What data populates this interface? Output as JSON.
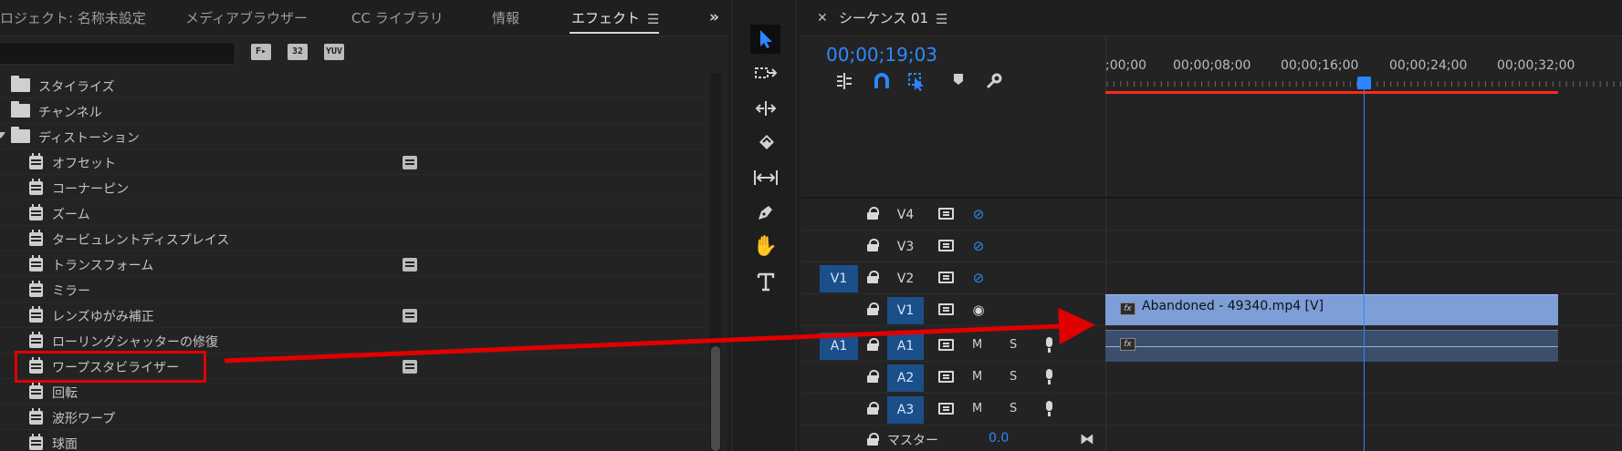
{
  "effects_panel": {
    "tabs": [
      "ロジェクト: 名称未設定",
      "メディアブラウザー",
      "CC ライブラリ",
      "情報",
      "エフェクト"
    ],
    "active_tab": "エフェクト",
    "search": {
      "value": "",
      "placeholder": ""
    },
    "filters": [
      "32",
      "YUV"
    ],
    "items": [
      {
        "label": "スタイライズ",
        "type": "folder"
      },
      {
        "label": "チャンネル",
        "type": "folder"
      },
      {
        "label": "ディストーション",
        "type": "folder",
        "expanded": true
      },
      {
        "label": "オフセット",
        "type": "effect",
        "accelerated": true
      },
      {
        "label": "コーナーピン",
        "type": "effect"
      },
      {
        "label": "ズーム",
        "type": "effect"
      },
      {
        "label": "タービュレントディスプレイス",
        "type": "effect"
      },
      {
        "label": "トランスフォーム",
        "type": "effect",
        "accelerated": true
      },
      {
        "label": "ミラー",
        "type": "effect"
      },
      {
        "label": "レンズゆがみ補正",
        "type": "effect",
        "accelerated": true
      },
      {
        "label": "ローリングシャッターの修復",
        "type": "effect"
      },
      {
        "label": "ワープスタビライザー",
        "type": "effect",
        "accelerated": true,
        "highlighted": true
      },
      {
        "label": "回転",
        "type": "effect"
      },
      {
        "label": "波形ワープ",
        "type": "effect"
      },
      {
        "label": "球面",
        "type": "effect"
      }
    ]
  },
  "timeline": {
    "sequence_tab": "シーケンス 01",
    "timecode": "00;00;19;03",
    "ruler_labels": [
      ";00;00",
      "00;00;08;00",
      "00;00;16;00",
      "00;00;24;00",
      "00;00;32;00"
    ],
    "tracks": [
      {
        "name": "V4",
        "kind": "video",
        "visible": false
      },
      {
        "name": "V3",
        "kind": "video",
        "visible": false
      },
      {
        "name": "V2",
        "kind": "video",
        "visible": false,
        "source_patch": "V1"
      },
      {
        "name": "V1",
        "kind": "video",
        "visible": true,
        "targeted": true
      },
      {
        "name": "A1",
        "kind": "audio",
        "source_patch": "A1",
        "targeted": true
      },
      {
        "name": "A2",
        "kind": "audio",
        "targeted": true
      },
      {
        "name": "A3",
        "kind": "audio",
        "targeted": true
      }
    ],
    "mute_label": "M",
    "solo_label": "S",
    "master": {
      "label": "マスター",
      "value": "0.0"
    },
    "video_clip": {
      "label": "Abandoned - 49340.mp4 [V]",
      "fx": "fx"
    },
    "audio_clip": {
      "fx": "fx"
    }
  },
  "colors": {
    "accent_blue": "#2b86ff",
    "target_blue": "#1b4f8a",
    "video_clip": "#7d9ed7",
    "audio_clip": "#3b4e6c",
    "annotation_red": "#e10000",
    "workarea_red": "#ff2a1a"
  },
  "icons": {
    "tools": [
      "selection-tool-icon",
      "track-select-icon",
      "ripple-edit-icon",
      "razor-icon",
      "slip-icon",
      "pen-icon",
      "hand-icon",
      "type-icon"
    ],
    "timeline_controls": [
      "nest-icon",
      "snap-magnet-icon",
      "linked-selection-icon",
      "marker-icon",
      "wrench-icon"
    ]
  }
}
